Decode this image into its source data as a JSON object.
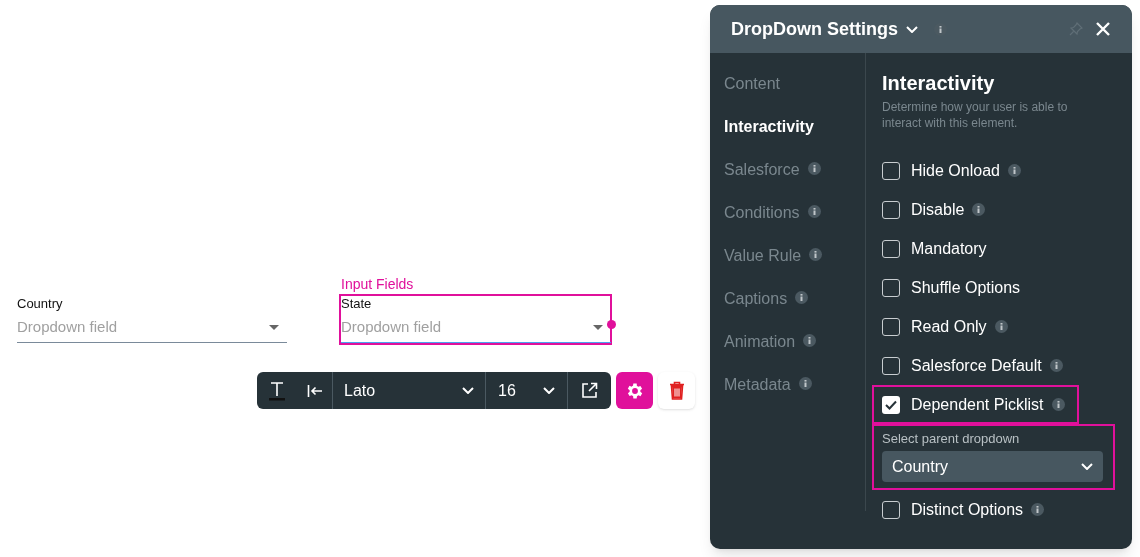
{
  "canvas": {
    "fields": [
      {
        "label": "Country",
        "placeholder": "Dropdown field",
        "selected": false
      },
      {
        "label": "State",
        "placeholder": "Dropdown field",
        "selected": true,
        "group_label": "Input Fields"
      }
    ]
  },
  "toolbar": {
    "font": "Lato",
    "size": "16"
  },
  "panel": {
    "title": "DropDown Settings",
    "nav": [
      {
        "label": "Content",
        "selected": false,
        "info": false
      },
      {
        "label": "Interactivity",
        "selected": true,
        "info": false
      },
      {
        "label": "Salesforce",
        "selected": false,
        "info": true
      },
      {
        "label": "Conditions",
        "selected": false,
        "info": true
      },
      {
        "label": "Value Rule",
        "selected": false,
        "info": true
      },
      {
        "label": "Captions",
        "selected": false,
        "info": true
      },
      {
        "label": "Animation",
        "selected": false,
        "info": true
      },
      {
        "label": "Metadata",
        "selected": false,
        "info": true
      }
    ],
    "heading": "Interactivity",
    "description": "Determine how your user is able to interact with this element.",
    "options": [
      {
        "label": "Hide Onload",
        "checked": false,
        "info": true,
        "highlighted": false
      },
      {
        "label": "Disable",
        "checked": false,
        "info": true,
        "highlighted": false
      },
      {
        "label": "Mandatory",
        "checked": false,
        "info": false,
        "highlighted": false
      },
      {
        "label": "Shuffle Options",
        "checked": false,
        "info": false,
        "highlighted": false
      },
      {
        "label": "Read Only",
        "checked": false,
        "info": true,
        "highlighted": false
      },
      {
        "label": "Salesforce Default",
        "checked": false,
        "info": true,
        "highlighted": false
      },
      {
        "label": "Dependent Picklist",
        "checked": true,
        "info": true,
        "highlighted": true,
        "parent": {
          "label": "Select parent dropdown",
          "value": "Country"
        }
      },
      {
        "label": "Distinct Options",
        "checked": false,
        "info": true,
        "highlighted": false
      }
    ]
  }
}
